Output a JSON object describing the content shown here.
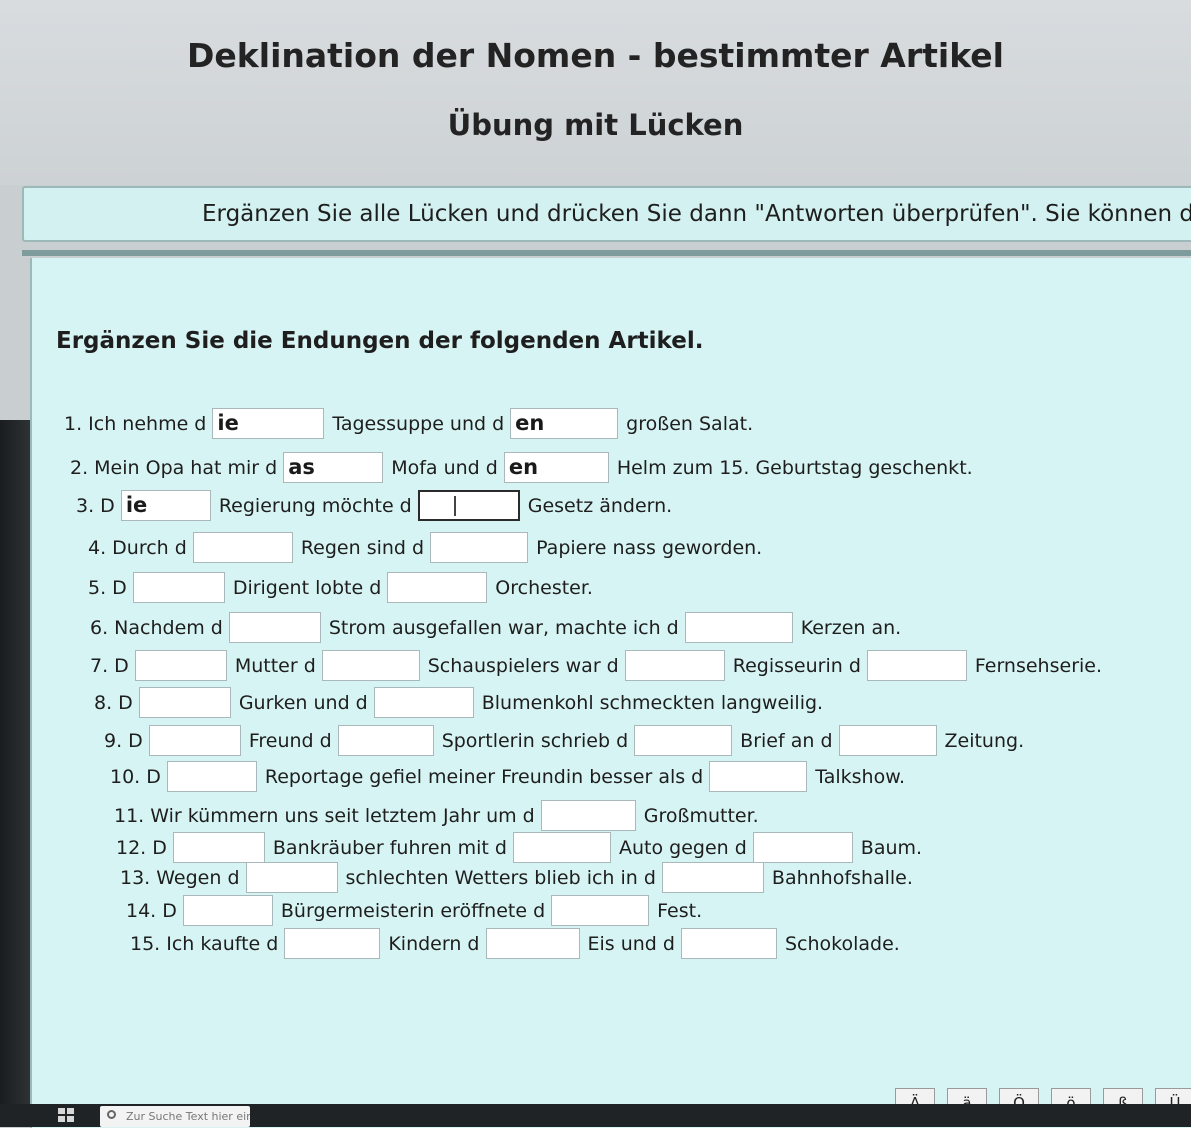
{
  "header": {
    "title": "Deklination der Nomen - bestimmter Artikel",
    "subtitle": "Übung mit Lücken"
  },
  "instruction": "Ergänzen Sie alle Lücken und drücken Sie dann \"Antworten überprüfen\". Sie können den",
  "task_heading": "Ergänzen Sie die Endungen der folgenden Artikel.",
  "sentences": [
    {
      "parts": [
        "1. Ich nehme d",
        {
          "v": "ie"
        },
        "Tagessuppe und d",
        {
          "v": "en"
        },
        "großen Salat."
      ]
    },
    {
      "parts": [
        "2. Mein Opa hat mir d",
        {
          "v": "as"
        },
        "Mofa und d",
        {
          "v": "en"
        },
        "Helm zum 15. Geburtstag geschenkt."
      ]
    },
    {
      "parts": [
        "3. D",
        {
          "v": "ie"
        },
        "Regierung möchte d",
        {
          "v": "",
          "focus": true
        },
        "Gesetz ändern."
      ]
    },
    {
      "parts": [
        "4. Durch d",
        {
          "v": ""
        },
        "Regen sind d",
        {
          "v": ""
        },
        "Papiere nass geworden."
      ]
    },
    {
      "parts": [
        "5. D",
        {
          "v": ""
        },
        "Dirigent lobte d",
        {
          "v": ""
        },
        "Orchester."
      ]
    },
    {
      "parts": [
        "6. Nachdem d",
        {
          "v": ""
        },
        "Strom ausgefallen war, machte ich d",
        {
          "v": ""
        },
        "Kerzen an."
      ]
    },
    {
      "parts": [
        "7. D",
        {
          "v": ""
        },
        "Mutter d",
        {
          "v": ""
        },
        "Schauspielers war d",
        {
          "v": ""
        },
        "Regisseurin d",
        {
          "v": ""
        },
        "Fernsehserie."
      ]
    },
    {
      "parts": [
        "8. D",
        {
          "v": ""
        },
        "Gurken und d",
        {
          "v": ""
        },
        "Blumenkohl schmeckten langweilig."
      ]
    },
    {
      "parts": [
        "9. D",
        {
          "v": ""
        },
        "Freund d",
        {
          "v": ""
        },
        "Sportlerin schrieb d",
        {
          "v": ""
        },
        "Brief an d",
        {
          "v": ""
        },
        "Zeitung."
      ]
    },
    {
      "parts": [
        "10. D",
        {
          "v": ""
        },
        "Reportage gefiel meiner Freundin besser als d",
        {
          "v": ""
        },
        "Talkshow."
      ]
    },
    {
      "parts": [
        "11. Wir kümmern uns seit letztem Jahr um d",
        {
          "v": ""
        },
        "Großmutter."
      ]
    },
    {
      "parts": [
        "12. D",
        {
          "v": ""
        },
        "Bankräuber fuhren mit d",
        {
          "v": ""
        },
        "Auto gegen d",
        {
          "v": ""
        },
        "Baum."
      ]
    },
    {
      "parts": [
        "13. Wegen d",
        {
          "v": ""
        },
        "schlechten Wetters blieb ich in d",
        {
          "v": ""
        },
        "Bahnhofshalle."
      ]
    },
    {
      "parts": [
        "14. D",
        {
          "v": ""
        },
        "Bürgermeisterin eröffnete d",
        {
          "v": ""
        },
        "Fest."
      ]
    },
    {
      "parts": [
        "15. Ich kaufte d",
        {
          "v": ""
        },
        "Kindern d",
        {
          "v": ""
        },
        "Eis und d",
        {
          "v": ""
        },
        "Schokolade."
      ]
    }
  ],
  "special_chars": [
    "Ä",
    "ä",
    "Ö",
    "ö",
    "ß",
    "Ü"
  ],
  "taskbar": {
    "search_placeholder": "Zur Suche Text hier eingeben"
  }
}
